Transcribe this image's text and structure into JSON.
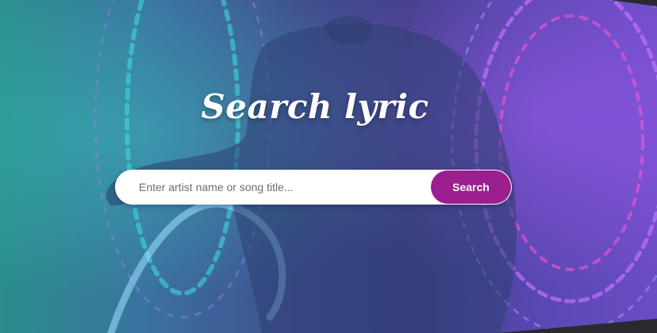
{
  "hero": {
    "title": "Search lyric",
    "background_description_colors": [
      "#2a8e8a",
      "#3f4f8e",
      "#6b4cc4",
      "#9b1f8f"
    ]
  },
  "search": {
    "placeholder": "Enter artist name or song title...",
    "value": "",
    "button_label": "Search",
    "button_color": "#9b1f8f"
  }
}
